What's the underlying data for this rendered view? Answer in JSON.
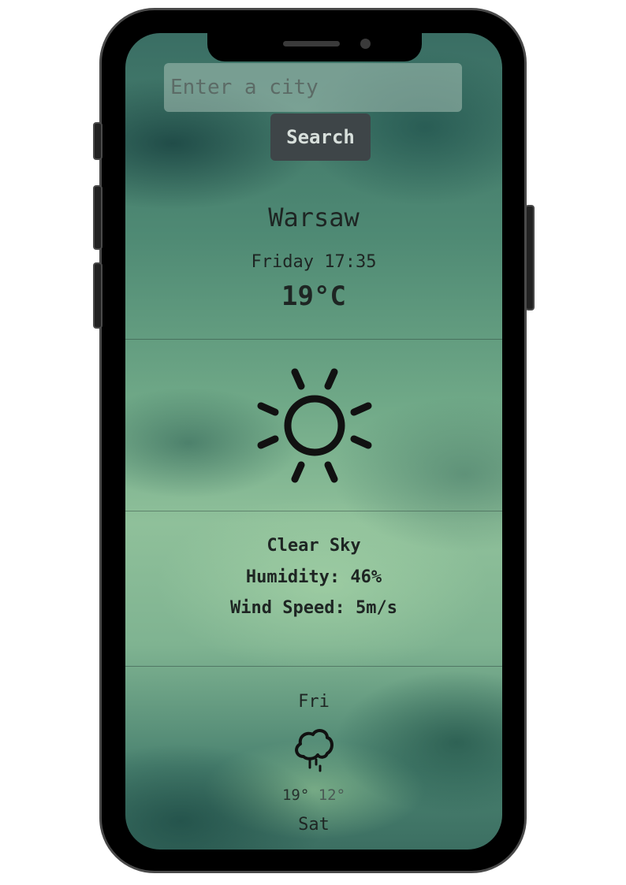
{
  "search": {
    "placeholder": "Enter a city",
    "value": "",
    "button_label": "Search"
  },
  "current": {
    "city": "Warsaw",
    "datetime": "Friday 17:35",
    "temperature": "19°C",
    "icon": "sun-icon",
    "description": "Clear Sky",
    "humidity": "Humidity: 46%",
    "wind_speed": "Wind Speed: 5m/s"
  },
  "forecast": [
    {
      "day": "Fri",
      "icon": "rain-cloud-icon",
      "max": "19°",
      "min": "12°"
    },
    {
      "day": "Sat"
    }
  ],
  "colors": {
    "text": "#1e2523",
    "button_bg": "#3e4548",
    "button_text": "#d8e0dc",
    "input_bg": "#bed2c8"
  }
}
